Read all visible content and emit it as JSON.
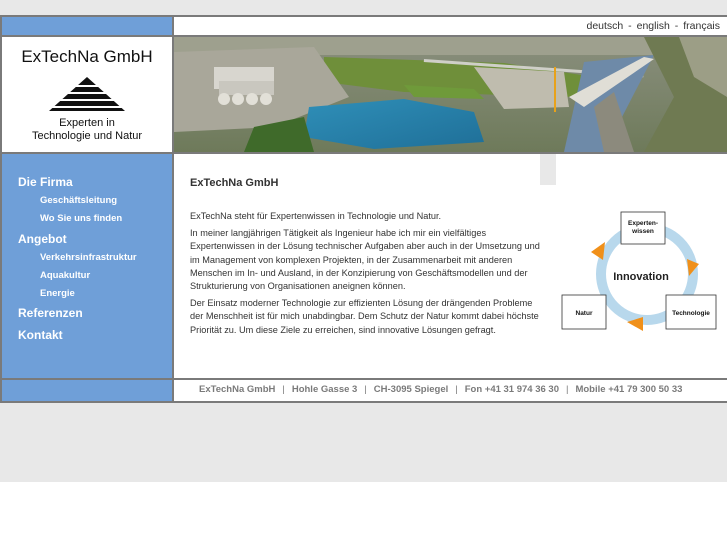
{
  "languages": [
    "deutsch",
    "english",
    "français"
  ],
  "logo": {
    "title": "ExTechNa GmbH",
    "subtitle_line1": "Experten in",
    "subtitle_line2": "Technologie und Natur"
  },
  "nav": {
    "die_firma": "Die Firma",
    "geschaeftsleitung": "Geschäftsleitung",
    "wo_sie_uns_finden": "Wo Sie uns finden",
    "angebot": "Angebot",
    "verkehrsinfrastruktur": "Verkehrsinfrastruktur",
    "aquakultur": "Aquakultur",
    "energie": "Energie",
    "referenzen": "Referenzen",
    "kontakt": "Kontakt"
  },
  "content": {
    "heading": "ExTechNa GmbH",
    "p1": "ExTechNa steht für Expertenwissen in Technologie und Natur.",
    "p2": "In meiner langjährigen Tätigkeit als Ingenieur habe ich mir ein vielfältiges Expertenwissen in der Lösung technischer Aufgaben aber auch in der Umsetzung und im Management von komplexen Projekten, in der Zusammenarbeit mit anderen Menschen im In- und Ausland, in der Konzipierung von Geschäftsmodellen und der Strukturierung von Organisationen aneignen können.",
    "p3": "Der Einsatz moderner Technologie zur effizienten Lösung der drängenden Probleme der Menschheit ist für mich unabdingbar. Dem Schutz der Natur kommt dabei höchste Priorität zu. Um diese Ziele zu erreichen, sind innovative Lösungen gefragt."
  },
  "diagram": {
    "center": "Innovation",
    "top_line1": "Experten-",
    "top_line2": "wissen",
    "left": "Natur",
    "right": "Technologie"
  },
  "footer": {
    "company": "ExTechNa  GmbH",
    "street": "Hohle Gasse 3",
    "city": "CH-3095 Spiegel",
    "phone": "Fon +41 31 974 36 30",
    "mobile": "Mobile +41 79 300 50 33"
  },
  "colors": {
    "nav_blue": "#6f9fd8",
    "arrow_orange": "#f0901a",
    "ring_blue": "#b8d8ec"
  }
}
